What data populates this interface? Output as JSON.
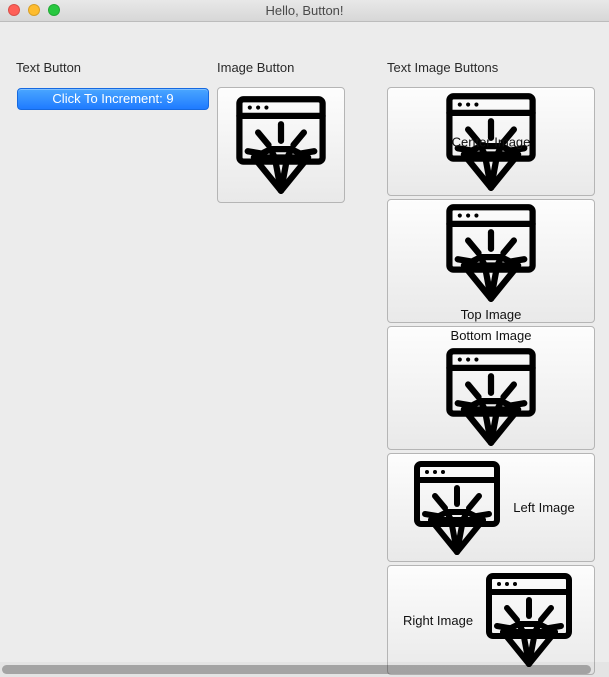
{
  "window": {
    "title": "Hello, Button!"
  },
  "headings": {
    "text_button": "Text Button",
    "image_button": "Image Button",
    "text_image_buttons": "Text Image Buttons"
  },
  "text_button": {
    "label_prefix": "Click To Increment: ",
    "count": 9,
    "full_label": "Click To Increment: 9"
  },
  "image_button": {
    "icon": "browser-diamond-icon"
  },
  "text_image_buttons": [
    {
      "label": "Center Image",
      "position": "center",
      "icon": "browser-diamond-icon"
    },
    {
      "label": "Top Image",
      "position": "top",
      "icon": "browser-diamond-icon"
    },
    {
      "label": "Bottom Image",
      "position": "bottom",
      "icon": "browser-diamond-icon"
    },
    {
      "label": "Left Image",
      "position": "left",
      "icon": "browser-diamond-icon"
    },
    {
      "label": "Right Image",
      "position": "right",
      "icon": "browser-diamond-icon"
    }
  ],
  "colors": {
    "window_bg": "#ececec",
    "primary_button": "#1f7bff"
  }
}
